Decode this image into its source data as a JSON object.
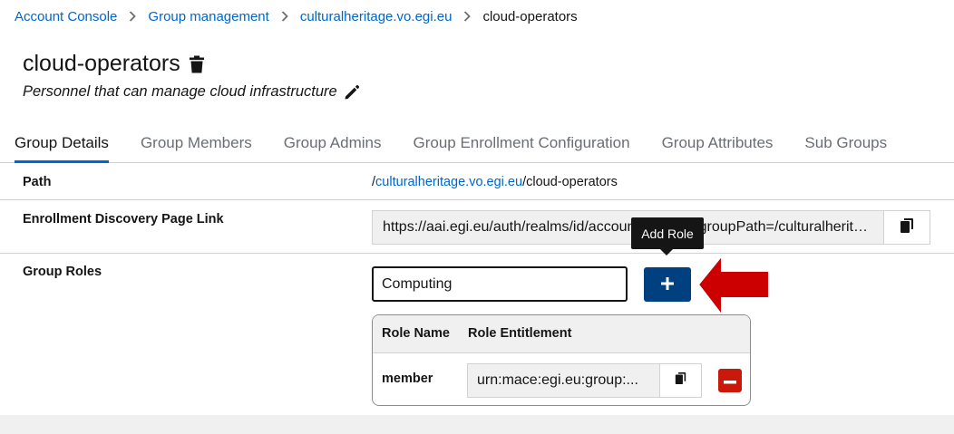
{
  "breadcrumb": {
    "items": [
      "Account Console",
      "Group management",
      "culturalheritage.vo.egi.eu"
    ],
    "current": "cloud-operators"
  },
  "page": {
    "title": "cloud-operators",
    "description": "Personnel that can manage cloud infrastructure"
  },
  "tabs": [
    {
      "label": "Group Details",
      "active": true
    },
    {
      "label": "Group Members"
    },
    {
      "label": "Group Admins"
    },
    {
      "label": "Group Enrollment Configuration"
    },
    {
      "label": "Group Attributes"
    },
    {
      "label": "Sub Groups"
    }
  ],
  "details": {
    "path_label": "Path",
    "path_prefix": "/",
    "path_link": "culturalheritage.vo.egi.eu",
    "path_suffix": "/cloud-operators",
    "enrollment_label": "Enrollment Discovery Page Link",
    "enrollment_url": "https://aai.egi.eu/auth/realms/id/account/#/enroll?groupPath=/culturalheritage.vo.egi.eu/cloud-operators",
    "roles_label": "Group Roles",
    "role_input_value": "Computing",
    "add_role_tooltip": "Add Role"
  },
  "roles_table": {
    "headers": [
      "Role Name",
      "Role Entitlement"
    ],
    "rows": [
      {
        "name": "member",
        "entitlement": "urn:mace:egi.eu:group:..."
      }
    ]
  },
  "icons": [
    "chevron-right-icon",
    "trash-icon",
    "pencil-icon",
    "copy-icon",
    "plus-icon",
    "minus-icon",
    "arrow-left-icon"
  ],
  "colors": {
    "link": "#0066cc",
    "primary_button": "#004080",
    "danger": "#c9190b",
    "annotation_arrow": "#cc0000",
    "tooltip_bg": "#151515"
  }
}
